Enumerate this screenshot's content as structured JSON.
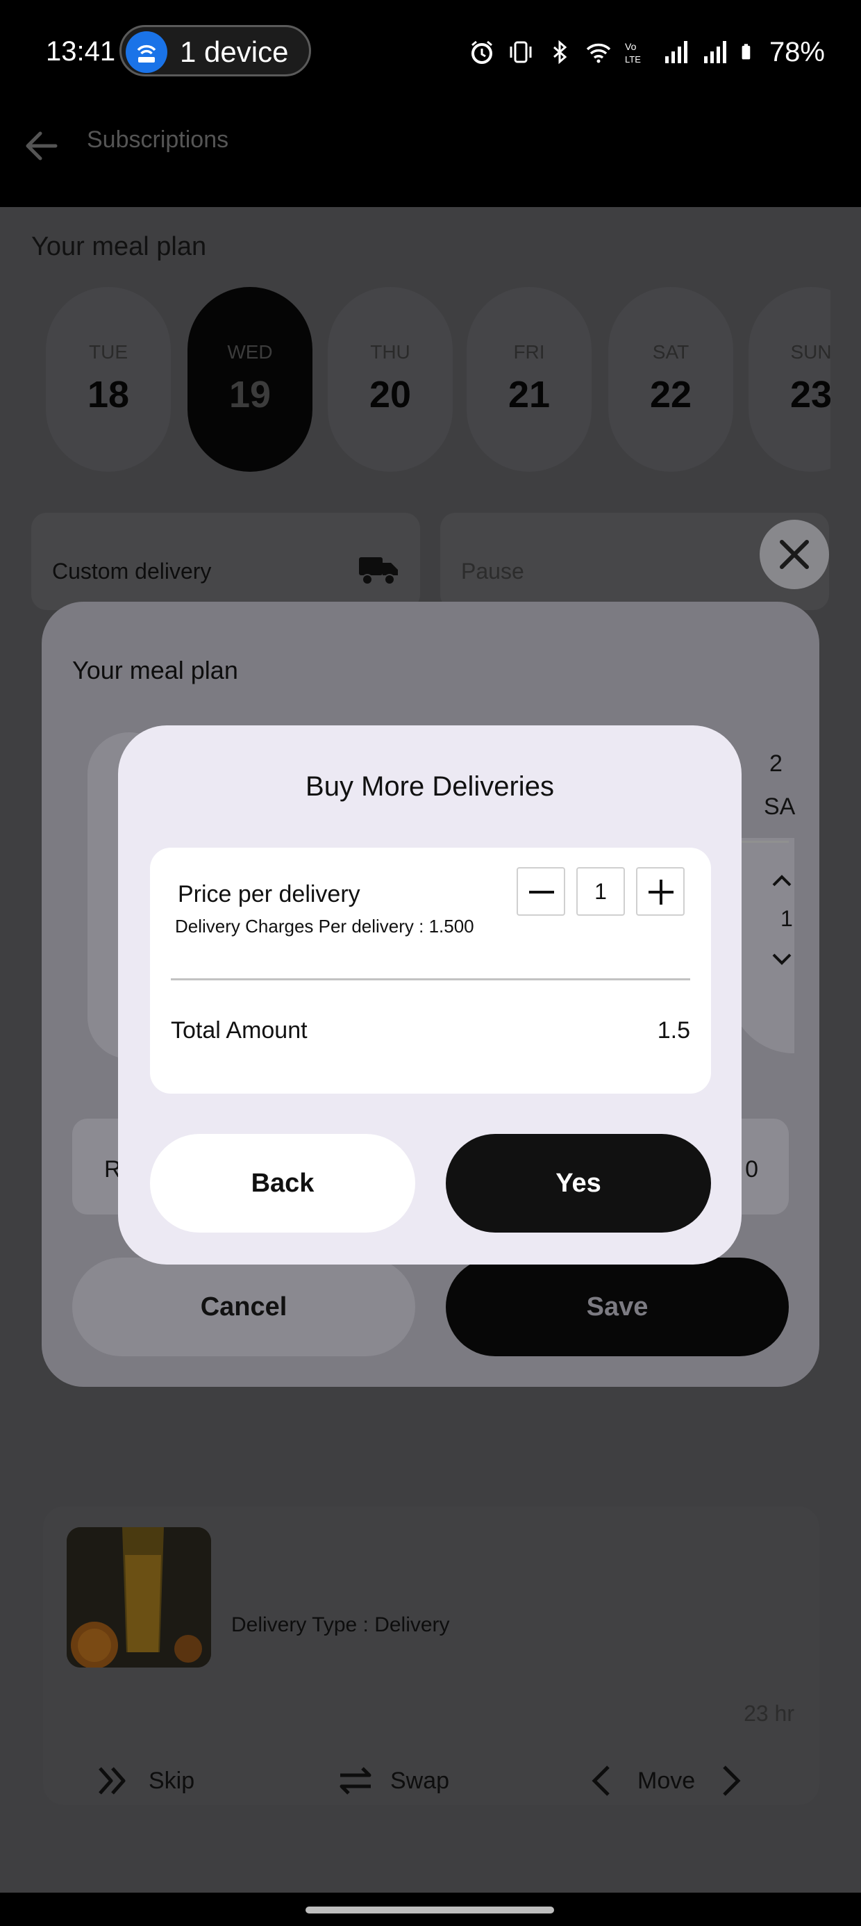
{
  "status_bar": {
    "time": "13:41",
    "device_pill": "1 device",
    "battery": "78%",
    "icons": [
      "alarm-icon",
      "vibrate-icon",
      "bluetooth-icon",
      "wifi-icon",
      "volte-icon",
      "signal-icon",
      "signal-icon",
      "battery-icon"
    ]
  },
  "app_bar": {
    "title": "Subscriptions"
  },
  "page": {
    "title": "Your meal plan",
    "days": [
      {
        "name": "TUE",
        "num": "18"
      },
      {
        "name": "WED",
        "num": "19",
        "active": true
      },
      {
        "name": "THU",
        "num": "20"
      },
      {
        "name": "FRI",
        "num": "21"
      },
      {
        "name": "SAT",
        "num": "22"
      },
      {
        "name": "SUN",
        "num": "23"
      }
    ],
    "options": {
      "custom_delivery": "Custom delivery",
      "pause": "Pause"
    },
    "delivery_type": "Delivery Type : Delivery",
    "hours_label": "23 hr",
    "actions": {
      "skip": "Skip",
      "swap": "Swap",
      "move": "Move"
    }
  },
  "sheet": {
    "title": "Your meal plan",
    "peek_num": "2",
    "peek_day": "SA",
    "peek_value": "1",
    "row_left": "R",
    "row_right": "0",
    "cancel_label": "Cancel",
    "save_label": "Save"
  },
  "dialog": {
    "title": "Buy More Deliveries",
    "price_label": "Price per delivery",
    "price_sub": "Delivery Charges Per delivery : 1.500",
    "quantity": "1",
    "total_label": "Total Amount",
    "total_value": "1.5",
    "back_label": "Back",
    "yes_label": "Yes"
  },
  "colors": {
    "dialog_bg": "#ece9f3",
    "primary_button": "#111111",
    "scrim": "#3f3f41"
  }
}
